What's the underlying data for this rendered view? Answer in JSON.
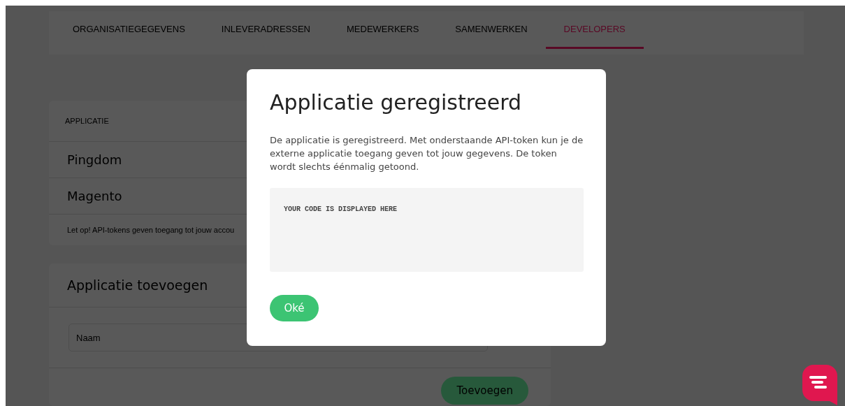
{
  "tabs": [
    {
      "label": "ORGANISATIEGEGEVENS",
      "selected": false
    },
    {
      "label": "INLEVERADRESSEN",
      "selected": false
    },
    {
      "label": "MEDEWERKERS",
      "selected": false
    },
    {
      "label": "SAMENWERKEN",
      "selected": false
    },
    {
      "label": "DEVELOPERS",
      "selected": true
    }
  ],
  "applications": {
    "column_header": "APPLICATIE",
    "rows": [
      "Pingdom",
      "Magento"
    ],
    "note": "Let op! API-tokens geven toegang tot jouw accou"
  },
  "add_application": {
    "title": "Applicatie toevoegen",
    "name_field": {
      "placeholder": "Naam"
    },
    "submit": "Toevoegen"
  },
  "modal": {
    "title": "Applicatie geregistreerd",
    "text": "De applicatie is geregistreerd. Met onderstaande API-token kun je de externe applicatie toegang geven tot jouw gegevens. De token wordt slechts éénmalig getoond.",
    "code": "YOUR CODE IS DISPLAYED HERE",
    "ok_button": "Oké"
  }
}
